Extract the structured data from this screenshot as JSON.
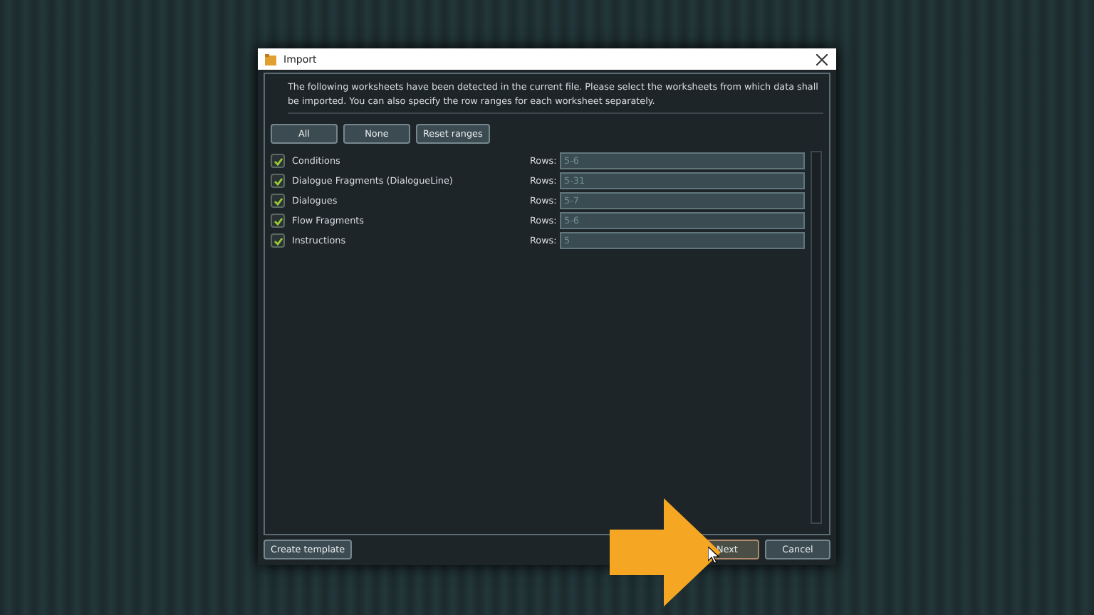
{
  "window": {
    "title": "Import"
  },
  "intro": "The following worksheets have been detected in the current file. Please select the worksheets from which data shall be imported. You can also specify the row ranges for each worksheet separately.",
  "selection_buttons": [
    "All",
    "None",
    "Reset ranges"
  ],
  "worksheets": [
    {
      "name": "Conditions",
      "checked": true,
      "rows_label": "Rows:",
      "rows": "5-6"
    },
    {
      "name": "Dialogue Fragments (DialogueLine)",
      "checked": true,
      "rows_label": "Rows:",
      "rows": "5-31"
    },
    {
      "name": "Dialogues",
      "checked": true,
      "rows_label": "Rows:",
      "rows": "5-7"
    },
    {
      "name": "Flow Fragments",
      "checked": true,
      "rows_label": "Rows:",
      "rows": "5-6"
    },
    {
      "name": "Instructions",
      "checked": true,
      "rows_label": "Rows:",
      "rows": "5"
    }
  ],
  "footer": {
    "template_button": "Create template",
    "next_button": "Next",
    "cancel_button": "Cancel"
  }
}
